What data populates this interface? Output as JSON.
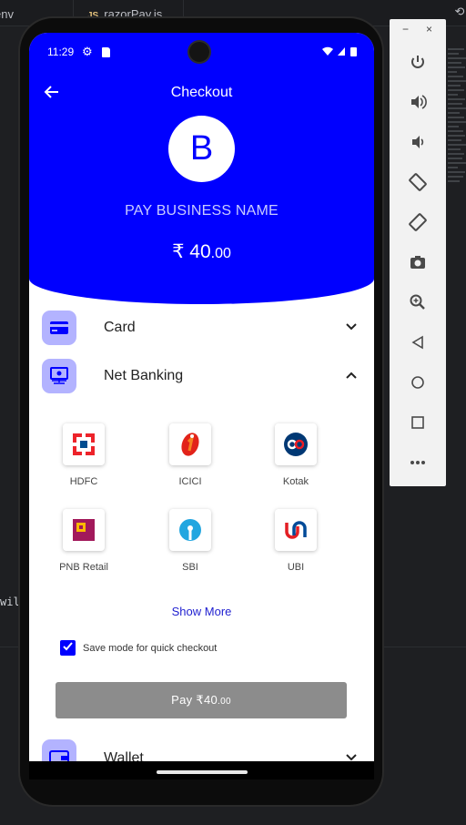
{
  "ide": {
    "tabs": [
      {
        "label": "env"
      },
      {
        "label": "razorPay.js",
        "badge": "JS"
      }
    ],
    "code_fragment": "wil"
  },
  "emulator": {
    "window_controls": {
      "minimize": "−",
      "close": "×"
    },
    "buttons": [
      "power-icon",
      "volume-up-icon",
      "volume-down-icon",
      "rotate-left-icon",
      "rotate-right-icon",
      "camera-icon",
      "zoom-icon",
      "back-icon",
      "home-icon",
      "overview-icon",
      "more-icon"
    ]
  },
  "status_bar": {
    "time": "11:29"
  },
  "checkout": {
    "title": "Checkout",
    "avatar_letter": "B",
    "business_name": "PAY BUSINESS NAME",
    "amount_currency": "₹",
    "amount_main": "40",
    "amount_decimal": ".00",
    "accent_color": "#0000ff"
  },
  "methods": [
    {
      "label": "Card",
      "expanded": false
    },
    {
      "label": "Net Banking",
      "expanded": true
    },
    {
      "label": "Wallet",
      "expanded": false
    }
  ],
  "banks": [
    {
      "name": "HDFC"
    },
    {
      "name": "ICICI"
    },
    {
      "name": "Kotak"
    },
    {
      "name": "PNB Retail"
    },
    {
      "name": "SBI"
    },
    {
      "name": "UBI"
    }
  ],
  "show_more": "Show More",
  "save_mode": {
    "label": "Save mode for quick checkout",
    "checked": true
  },
  "pay_button": {
    "label": "Pay ₹40",
    "decimal": ".00"
  }
}
